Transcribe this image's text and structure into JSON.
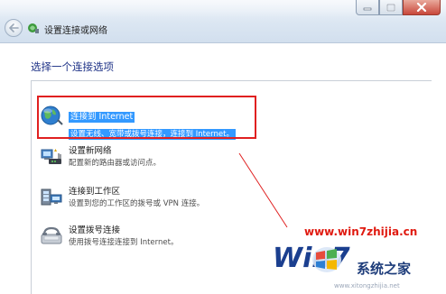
{
  "window": {
    "title": "设置连接或网络",
    "controls": [
      "minimize",
      "maximize",
      "close"
    ]
  },
  "main": {
    "heading": "选择一个连接选项",
    "options": [
      {
        "title": "连接到 Internet",
        "description": "设置无线、宽带或拨号连接，连接到 Internet。",
        "icon": "globe-network-icon",
        "selected": true
      },
      {
        "title": "设置新网络",
        "description": "配置新的路由器或访问点。",
        "icon": "router-network-icon",
        "selected": false
      },
      {
        "title": "连接到工作区",
        "description": "设置到您的工作区的拨号或 VPN 连接。",
        "icon": "workplace-connection-icon",
        "selected": false
      },
      {
        "title": "设置拨号连接",
        "description": "使用拨号连接连接到 Internet。",
        "icon": "dialup-modem-icon",
        "selected": false
      }
    ]
  },
  "watermark": {
    "url": "www.win7zhijia.cn",
    "logo_text": "Win7",
    "brand": "系统之家",
    "sub": "www.xitongzhijia.net"
  },
  "colors": {
    "highlight_box": "#e02020",
    "selection": "#3399ff",
    "heading": "#1e3287"
  }
}
